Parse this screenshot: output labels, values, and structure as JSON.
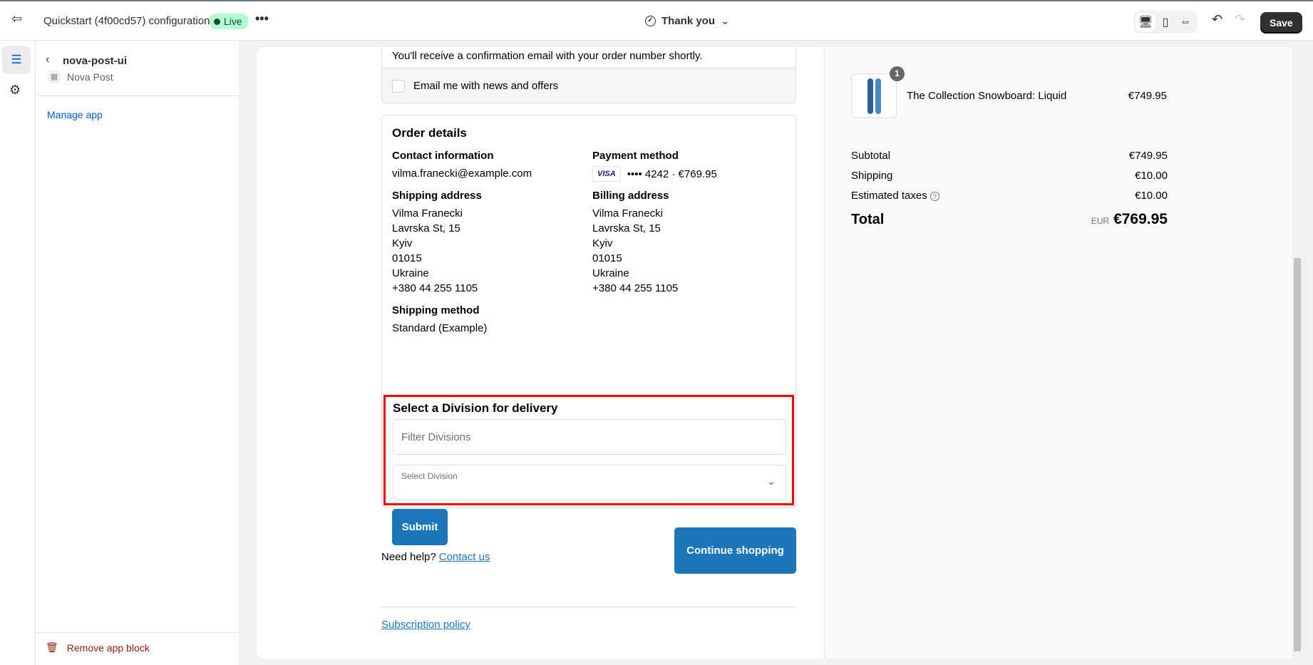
{
  "topbar": {
    "title": "Quickstart (4f00cd57) configuration",
    "status": "Live",
    "page_selector": "Thank you",
    "save": "Save"
  },
  "sidebar": {
    "app_name": "nova-post-ui",
    "app_source": "Nova Post",
    "manage_link": "Manage app",
    "remove_label": "Remove app block"
  },
  "checkout": {
    "confirmation_text": "You'll receive a confirmation email with your order number shortly.",
    "newsletter_label": "Email me with news and offers",
    "order_details_title": "Order details",
    "contact_label": "Contact information",
    "contact_email": "vilma.franecki@example.com",
    "payment_label": "Payment method",
    "card_brand": "VISA",
    "card_summary": "•••• 4242 · €769.95",
    "shipping_address_label": "Shipping address",
    "shipping_address": [
      "Vilma Franecki",
      "Lavrska St, 15",
      "Kyiv",
      "01015",
      "Ukraine",
      "+380 44 255 1105"
    ],
    "billing_address_label": "Billing address",
    "billing_address": [
      "Vilma Franecki",
      "Lavrska St, 15",
      "Kyiv",
      "01015",
      "Ukraine",
      "+380 44 255 1105"
    ],
    "shipping_method_label": "Shipping method",
    "shipping_method": "Standard (Example)",
    "division_title": "Select a Division for delivery",
    "filter_placeholder": "Filter Divisions",
    "select_label": "Select Division",
    "submit": "Submit",
    "help_text": "Need help?",
    "contact_link": "Contact us",
    "continue_button": "Continue shopping",
    "policy_link": "Subscription policy"
  },
  "summary": {
    "item": {
      "name": "The Collection Snowboard: Liquid",
      "price": "€749.95",
      "quantity": "1"
    },
    "subtotal_label": "Subtotal",
    "subtotal": "€749.95",
    "shipping_label": "Shipping",
    "shipping": "€10.00",
    "taxes_label": "Estimated taxes",
    "taxes": "€10.00",
    "total_label": "Total",
    "currency": "EUR",
    "total": "€769.95"
  },
  "colors": {
    "accent": "#1c76b9",
    "highlight": "#ff0000",
    "live_badge": "#b4fed2"
  }
}
